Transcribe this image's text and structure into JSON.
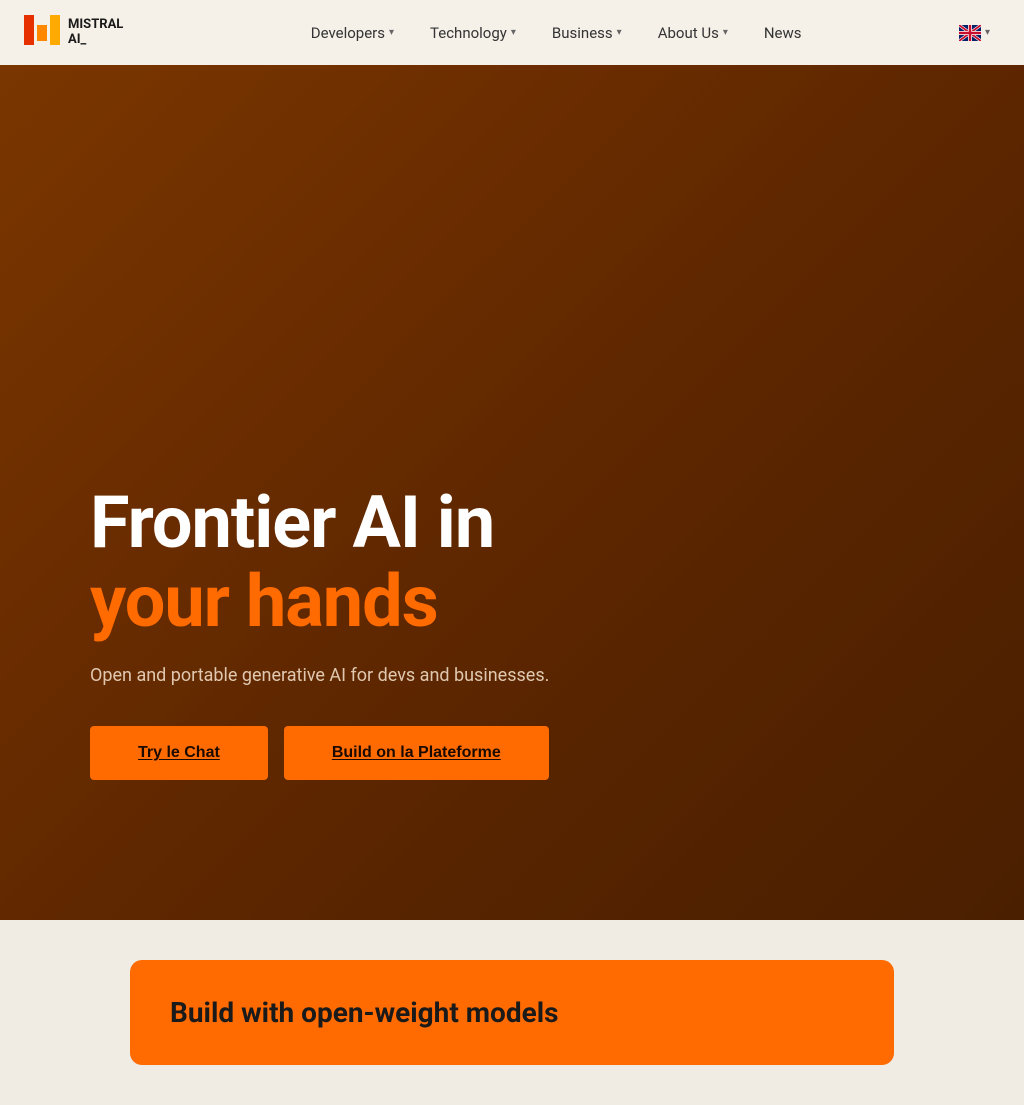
{
  "navbar": {
    "logo": {
      "text_line1": "MISTRAL",
      "text_line2": "AI_"
    },
    "nav_items": [
      {
        "label": "Developers",
        "has_dropdown": true
      },
      {
        "label": "Technology",
        "has_dropdown": true
      },
      {
        "label": "Business",
        "has_dropdown": true
      },
      {
        "label": "About Us",
        "has_dropdown": true
      },
      {
        "label": "News",
        "has_dropdown": false
      }
    ],
    "language": {
      "code": "EN",
      "has_dropdown": true
    }
  },
  "hero": {
    "title_white": "Frontier AI in",
    "title_orange": "your hands",
    "subtitle": "Open and portable generative AI for devs and businesses.",
    "btn_primary": "Try le Chat",
    "btn_secondary": "Build on la Plateforme"
  },
  "lower": {
    "title": "Build with open-weight models"
  },
  "colors": {
    "orange": "#ff6b00",
    "hero_bg": "#6b2d00",
    "navbar_bg": "#f5f0e8",
    "lower_bg": "#f0ece4"
  }
}
